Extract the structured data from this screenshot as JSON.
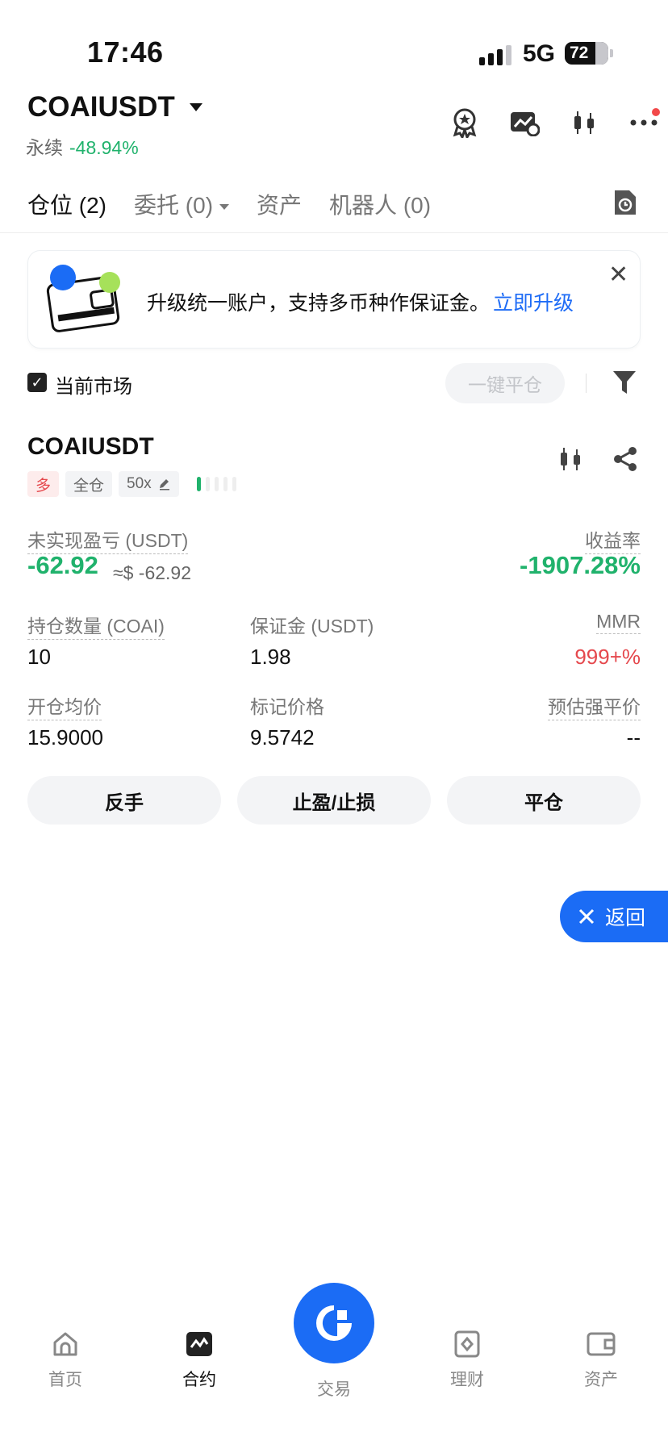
{
  "status_bar": {
    "time": "17:46",
    "network": "5G",
    "battery": "72"
  },
  "header": {
    "symbol": "COAIUSDT",
    "contract_type": "永续",
    "change": "-48.94%",
    "icons": [
      "badge-icon",
      "chart-alert-icon",
      "candlestick-icon",
      "more-icon"
    ]
  },
  "tabs": [
    {
      "label": "仓位 (2)",
      "active": true
    },
    {
      "label": "委托 (0)",
      "active": false,
      "dropdown": true
    },
    {
      "label": "资产",
      "active": false
    },
    {
      "label": "机器人 (0)",
      "active": false
    }
  ],
  "banner": {
    "text": "升级统一账户，支持多币种作保证金。",
    "link": "立即升级"
  },
  "filter": {
    "current_market_label": "当前市场",
    "checked": true,
    "close_all_label": "一键平仓"
  },
  "position": {
    "symbol": "COAIUSDT",
    "side": "多",
    "margin_mode": "全仓",
    "leverage": "50x",
    "adl_level": 1,
    "unrealized_pnl_label": "未实现盈亏 (USDT)",
    "unrealized_pnl": "-62.92",
    "unrealized_pnl_usd": "≈$ -62.92",
    "roe_label": "收益率",
    "roe": "-1907.28%",
    "size_label": "持仓数量 (COAI)",
    "size": "10",
    "margin_label": "保证金 (USDT)",
    "margin": "1.98",
    "mmr_label": "MMR",
    "mmr": "999+%",
    "entry_price_label": "开仓均价",
    "entry_price": "15.9000",
    "mark_price_label": "标记价格",
    "mark_price": "9.5742",
    "liq_price_label": "预估强平价",
    "liq_price": "--",
    "buttons": {
      "reverse": "反手",
      "tpsl": "止盈/止损",
      "close": "平仓"
    }
  },
  "float_button": {
    "label": "返回"
  },
  "bottom_nav": [
    {
      "label": "首页",
      "icon": "home-icon",
      "active": false
    },
    {
      "label": "合约",
      "icon": "futures-icon",
      "active": true
    },
    {
      "label": "交易",
      "icon": "trade-icon",
      "active": false
    },
    {
      "label": "理财",
      "icon": "earn-icon",
      "active": false
    },
    {
      "label": "资产",
      "icon": "wallet-icon",
      "active": false
    }
  ],
  "colors": {
    "accent": "#1b6cf5",
    "up": "#20b26c",
    "down": "#e5484d"
  }
}
